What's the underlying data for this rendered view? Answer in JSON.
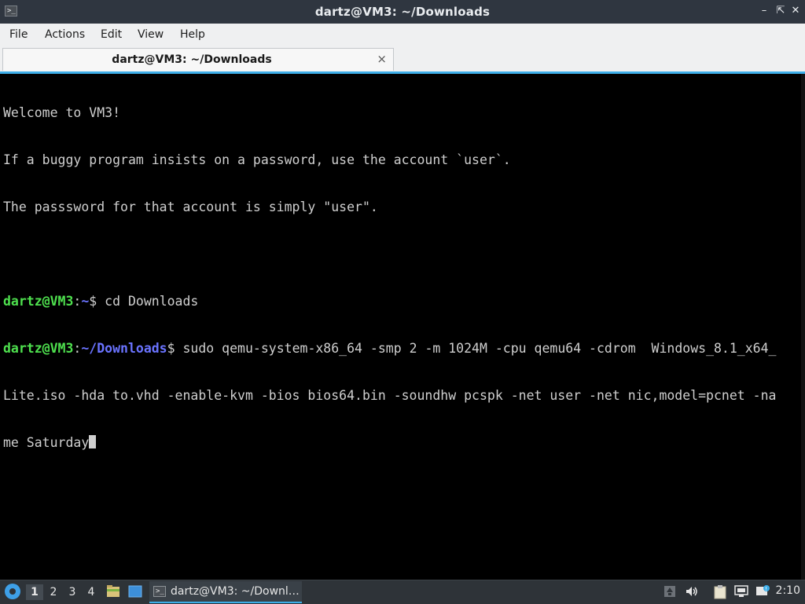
{
  "window": {
    "title": "dartz@VM3: ~/Downloads",
    "app_icon": ">_",
    "buttons": {
      "minimize": "–",
      "maximize": "⇱",
      "close": "✕"
    }
  },
  "menubar": {
    "items": [
      "File",
      "Actions",
      "Edit",
      "View",
      "Help"
    ]
  },
  "tabs": [
    {
      "label": "dartz@VM3: ~/Downloads",
      "close": "×"
    }
  ],
  "terminal": {
    "motd": [
      "Welcome to VM3!",
      "If a buggy program insists on a password, use the account `user`.",
      "The passsword for that account is simply \"user\"."
    ],
    "prompt1": {
      "user": "dartz@VM3",
      "sep": ":",
      "path": "~",
      "symbol": "$",
      "command": " cd Downloads"
    },
    "prompt2": {
      "user": "dartz@VM3",
      "sep": ":",
      "path": "~/Downloads",
      "symbol": "$",
      "command_line1": " sudo qemu-system-x86_64 -smp 2 -m 1024M -cpu qemu64 -cdrom  Windows_8.1_x64_",
      "command_line2": "Lite.iso -hda to.vhd -enable-kvm -bios bios64.bin -soundhw pcspk -net user -net nic,model=pcnet -na",
      "command_line3": "me Saturday"
    }
  },
  "taskbar": {
    "workspaces": [
      "1",
      "2",
      "3",
      "4"
    ],
    "active_workspace": "1",
    "task": {
      "label": "dartz@VM3: ~/Downl…",
      "icon": ">_"
    },
    "clock": "2:10"
  },
  "colors": {
    "accent": "#3daee9",
    "prompt_user": "#4ee04e",
    "prompt_path": "#6a73ff",
    "terminal_bg": "#000000"
  }
}
